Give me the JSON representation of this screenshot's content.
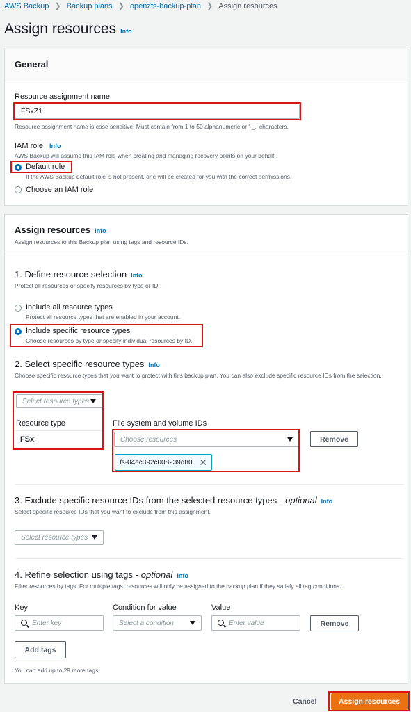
{
  "breadcrumb": [
    "AWS Backup",
    "Backup plans",
    "openzfs-backup-plan",
    "Assign resources"
  ],
  "page_title": "Assign resources",
  "info_label": "Info",
  "general": {
    "title": "General",
    "name_label": "Resource assignment name",
    "name_value": "FSxZ1",
    "name_hint": "Resource assignment name is case sensitive. Must contain from 1 to 50 alphanumeric or '-_.' characters.",
    "iam_label": "IAM role",
    "iam_desc": "AWS Backup will assume this IAM role when creating and managing recovery points on your behalf.",
    "default_role": "Default role",
    "default_role_desc": "If the AWS Backup default role is not present, one will be created for you with the correct permissions.",
    "choose_role": "Choose an IAM role"
  },
  "assign": {
    "title": "Assign resources",
    "desc": "Assign resources to this Backup plan using tags and resource IDs.",
    "step1_title": "1. Define resource selection",
    "step1_desc": "Protect all resources or specify resources by type or ID.",
    "opt_all": "Include all resource types",
    "opt_all_desc": "Protect all resource types that are enabled in your account.",
    "opt_specific": "Include specific resource types",
    "opt_specific_desc": "Choose resources by type or specify individual resources by ID.",
    "step2_title": "2. Select specific resource types",
    "step2_desc": "Choose specific resource types that you want to protect with this backup plan. You can also exclude specific resource IDs from the selection.",
    "select_types_placeholder": "Select resource types",
    "resource_type_label": "Resource type",
    "resource_type_value": "FSx",
    "fs_ids_label": "File system and volume IDs",
    "choose_resources_placeholder": "Choose resources",
    "remove_label": "Remove",
    "token_value": "fs-04ec392c008239d80",
    "step3_title": "3. Exclude specific resource IDs from the selected resource types -",
    "step3_optional": "optional",
    "step3_desc": "Select specific resource IDs that you want to exclude from this assignment.",
    "step4_title": "4. Refine selection using tags -",
    "step4_optional": "optional",
    "step4_desc": "Filter resources by tags. For multiple tags, resources will only be assigned to the backup plan if they satisfy all tag conditions.",
    "key_label": "Key",
    "key_placeholder": "Enter key",
    "condition_label": "Condition for value",
    "condition_placeholder": "Select a condition",
    "value_label": "Value",
    "value_placeholder": "Enter value",
    "add_tags": "Add tags",
    "tags_hint": "You can add up to 29 more tags."
  },
  "footer": {
    "cancel": "Cancel",
    "submit": "Assign resources"
  }
}
